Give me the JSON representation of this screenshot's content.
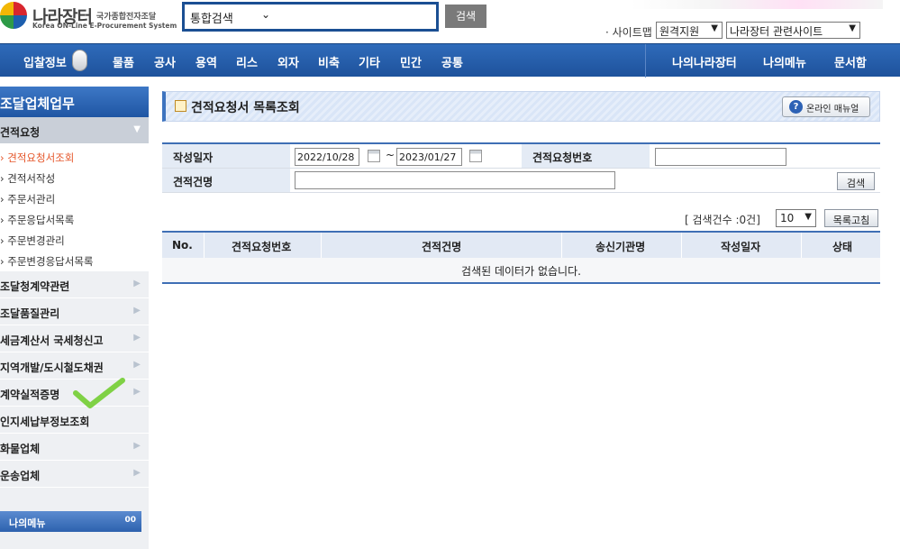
{
  "header": {
    "logo_title": "나라장터",
    "logo_subtitle": "국가종합전자조달",
    "logo_english": "Korea ON-Line E-Procurement System",
    "search_select": "통합검색",
    "search_button": "검색",
    "sitemap": "· 사이트맵",
    "remote_support": "원격지원",
    "related_sites": "나라장터 관련사이트"
  },
  "nav": {
    "left": [
      "입찰정보",
      "물품",
      "공사",
      "용역",
      "리스",
      "외자",
      "비축",
      "기타",
      "민간",
      "공통"
    ],
    "right": [
      "나의나라장터",
      "나의메뉴",
      "문서함"
    ]
  },
  "sidebar": {
    "title": "조달업체업무",
    "active_category": "견적요청",
    "sub_items": [
      "견적요청서조회",
      "견적서작성",
      "주문서관리",
      "주문응답서목록",
      "주문변경관리",
      "주문변경응답서목록"
    ],
    "categories": [
      "조달청계약관련",
      "조달품질관리",
      "세금계산서 국세청신고",
      "지역개발/도시철도채권",
      "계약실적증명",
      "인지세납부정보조회",
      "화물업체",
      "운송업체"
    ],
    "my_menu": "나의메뉴",
    "my_menu_icon": "00"
  },
  "page": {
    "title": "견적요청서 목록조회",
    "manual_button": "온라인 매뉴얼",
    "form": {
      "date_label": "작성일자",
      "date_from": "2022/10/28",
      "date_tilde": "~",
      "date_to": "2023/01/27",
      "request_no_label": "견적요청번호",
      "request_no_value": "",
      "name_label": "견적건명",
      "name_value": "",
      "search_button": "검색"
    },
    "count_text": "[ 검색건수 :0건]",
    "page_size": "10",
    "refresh_button": "목록고침",
    "table": {
      "headers": [
        "No.",
        "견적요청번호",
        "견적건명",
        "송신기관명",
        "작성일자",
        "상태"
      ],
      "empty_message": "검색된 데이터가 없습니다."
    }
  }
}
